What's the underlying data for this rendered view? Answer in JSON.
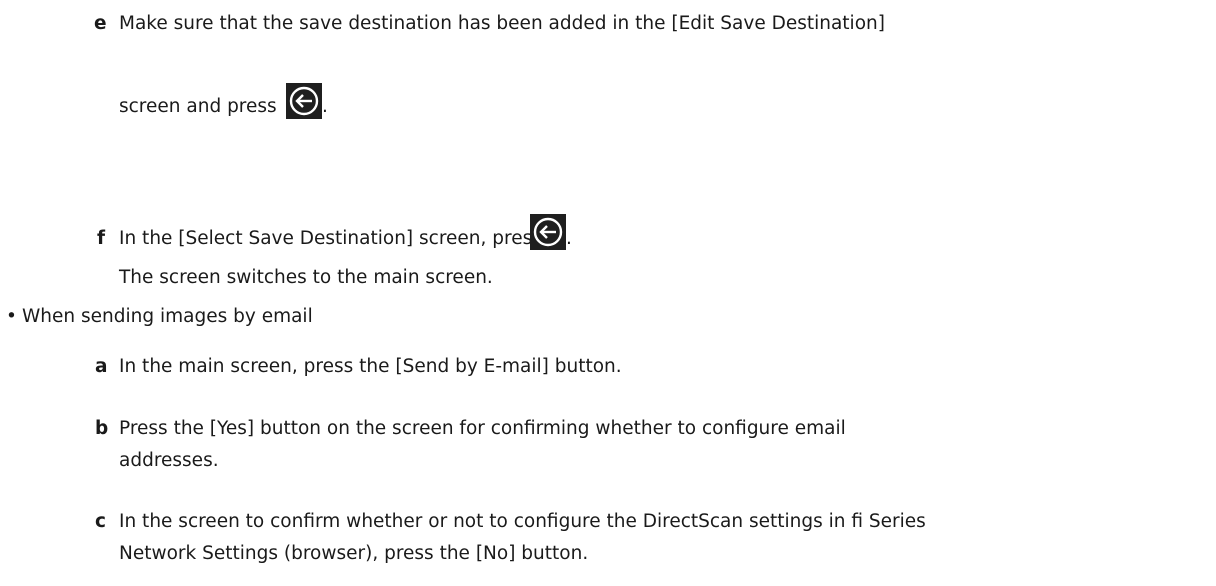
{
  "section1": {
    "steps": [
      {
        "letter": "e",
        "line1": "Make sure that the save destination has been added in the [Edit Save Destination]",
        "line2_before": "screen and press",
        "line2_after": ".",
        "icon": "back-arrow-circle-icon"
      },
      {
        "letter": "f",
        "line1_before": "In the [Select Save Destination] screen, press",
        "line1_after": ".",
        "line2": "The screen switches to the main screen.",
        "icon": "back-arrow-circle-icon"
      }
    ]
  },
  "section2": {
    "bullet": "•",
    "heading": "When sending images by email",
    "steps": [
      {
        "letter": "a",
        "line1": "In the main screen, press the [Send by E-mail] button."
      },
      {
        "letter": "b",
        "line1": "Press the [Yes] button on the screen for confirming whether to configure email",
        "line2": "addresses."
      },
      {
        "letter": "c",
        "line1": "In the screen to confirm whether or not to configure the DirectScan settings in fi Series",
        "line2": "Network Settings (browser), press the [No] button."
      }
    ]
  },
  "colors": {
    "text": "#1a1a1a",
    "icon_bg": "#1f1f1f",
    "icon_fg": "#ffffff"
  }
}
